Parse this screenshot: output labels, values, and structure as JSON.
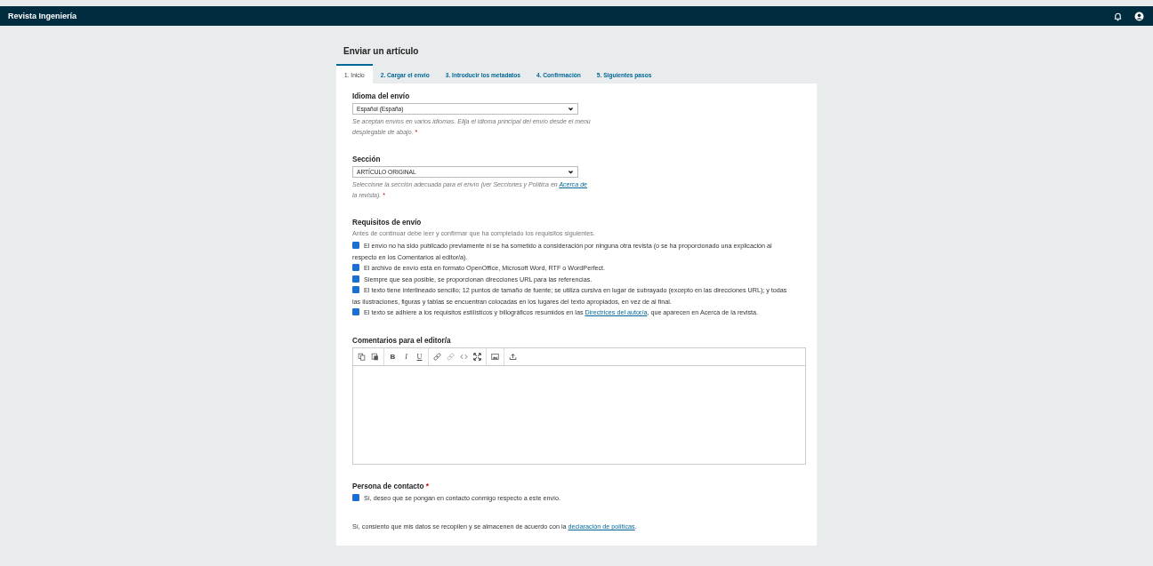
{
  "header": {
    "title": "Revista Ingeniería"
  },
  "page_title": "Enviar un artículo",
  "tabs": [
    {
      "label": "1. Inicio",
      "selected": true
    },
    {
      "label": "2. Cargar el envío",
      "selected": false
    },
    {
      "label": "3. Introducir los metadatos",
      "selected": false
    },
    {
      "label": "4. Confirmación",
      "selected": false
    },
    {
      "label": "5. Siguientes pasos",
      "selected": false
    }
  ],
  "selects": [
    {
      "label": "Idioma del envío",
      "value": "Español (España)",
      "help": [
        {
          "text": "Se aceptan envíos en varios idiomas. Elija el idioma principal del envío desde el menú desplegable de abajo."
        }
      ],
      "required_mark": "*"
    },
    {
      "label": "Sección",
      "value": "ARTÍCULO ORIGINAL",
      "help": [
        {
          "text": "Seleccione la sección adecuada para el envío (ver Secciones y Política en "
        },
        {
          "link": "Acerca de"
        },
        {
          "text": " la revista)."
        }
      ],
      "required_mark": "*"
    }
  ],
  "requirements": {
    "title": "Requisitos de envío",
    "intro": "Antes de continuar debe leer y confirmar que ha completado los requisitos siguientes.",
    "items": [
      {
        "checked": true,
        "parts": [
          {
            "text": "El envío no ha sido publicado previamente ni se ha sometido a consideración por ninguna otra revista (o se ha proporcionado una explicación al respecto en los Comentarios al editor/a)."
          }
        ]
      },
      {
        "checked": true,
        "parts": [
          {
            "text": "El archivo de envío está en formato OpenOffice, Microsoft Word, RTF o WordPerfect."
          }
        ]
      },
      {
        "checked": true,
        "parts": [
          {
            "text": "Siempre que sea posible, se proporcionan direcciones URL para las referencias."
          }
        ]
      },
      {
        "checked": true,
        "parts": [
          {
            "text": "El texto tiene interlineado sencillo; 12 puntos de tamaño de fuente; se utiliza cursiva en lugar de subrayado (excepto en las direcciones URL); y todas las ilustraciones, figuras y tablas se encuentran colocadas en los lugares del texto apropiados, en vez de al final."
          }
        ]
      },
      {
        "checked": true,
        "parts": [
          {
            "text": "El texto se adhiere a los requisitos estilísticos y biliográficos resumidos en las "
          },
          {
            "link": "Directrices del autor/a"
          },
          {
            "text": ", que aparecen en Acerca de la revista."
          }
        ]
      }
    ]
  },
  "editor": {
    "label": "Comentarios para el editor/a",
    "toolbar": [
      [
        {
          "kind": "copy"
        },
        {
          "kind": "paste"
        }
      ],
      [
        {
          "kind": "bold",
          "char": "B"
        },
        {
          "kind": "italic",
          "char": "I"
        },
        {
          "kind": "underline",
          "char": "U"
        }
      ],
      [
        {
          "kind": "link"
        },
        {
          "kind": "unlink"
        },
        {
          "kind": "code"
        },
        {
          "kind": "fullscreen"
        }
      ],
      [
        {
          "kind": "image"
        }
      ],
      [
        {
          "kind": "upload"
        }
      ]
    ]
  },
  "contact": {
    "label": "Persona de contacto",
    "required_mark": "*",
    "checked": true,
    "text": "Sí, deseo que se pongan en contacto conmigo respecto a este envío."
  },
  "consent": [
    {
      "text": "Sí, consiento que mis datos se recopilen y se almacenen de acuerdo con la "
    },
    {
      "link": "declaración de políticas"
    },
    {
      "text": "."
    }
  ]
}
